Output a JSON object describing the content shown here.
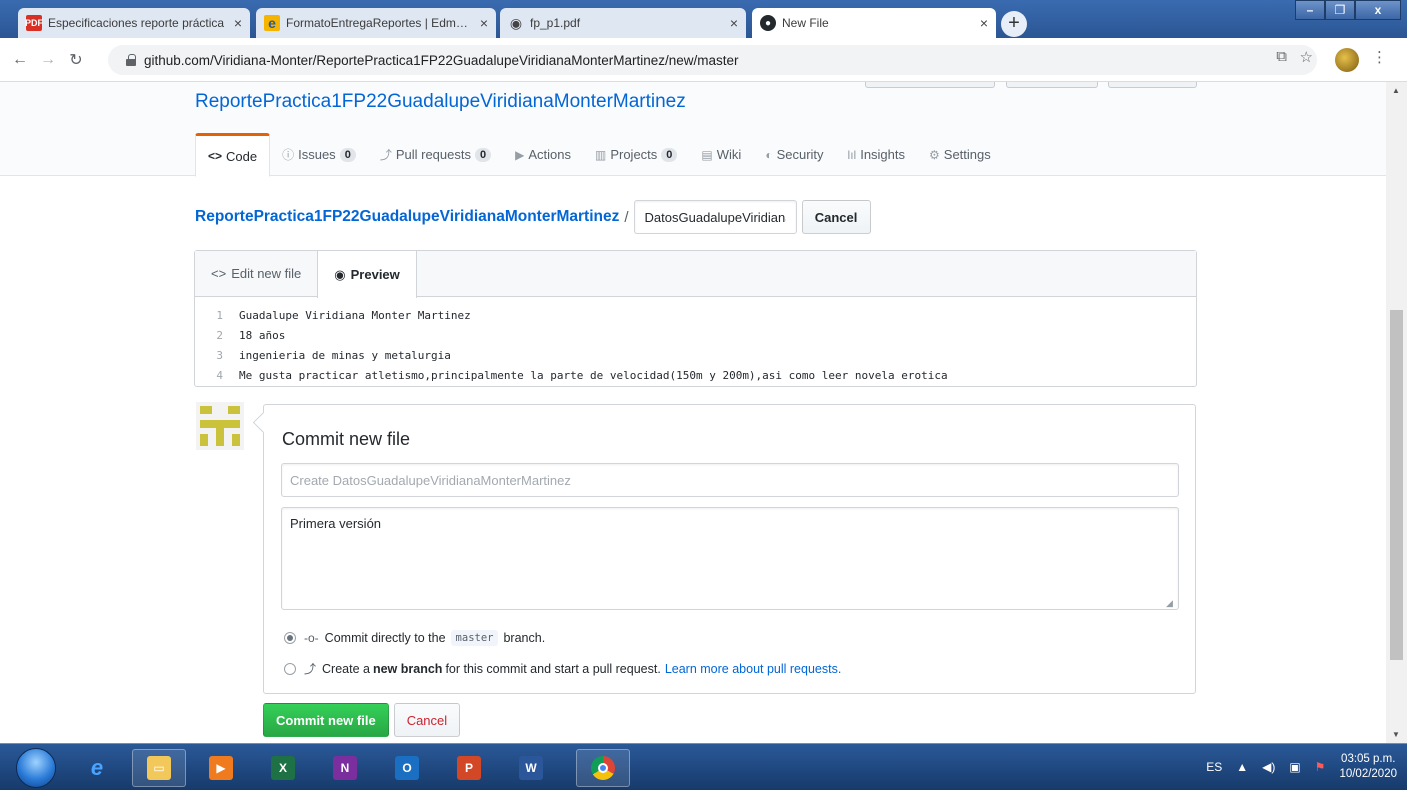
{
  "browser": {
    "tabs": [
      {
        "title": "Especificaciones reporte práctica",
        "favicon": "PDF"
      },
      {
        "title": "FormatoEntregaReportes | Edmodo",
        "favicon": "e"
      },
      {
        "title": "fp_p1.pdf",
        "favicon": "globe-icon"
      },
      {
        "title": "New File",
        "favicon": "github-icon"
      }
    ],
    "url": "github.com/Viridiana-Monter/ReportePractica1FP22GuadalupeViridianaMonterMartinez/new/master"
  },
  "repo": {
    "title": "ReportePractica1FP22GuadalupeViridianaMonterMartinez",
    "nav": [
      {
        "icon": "<>",
        "label": "Code"
      },
      {
        "icon": "ⓘ",
        "label": "Issues",
        "count": "0"
      },
      {
        "icon": "⤴",
        "label": "Pull requests",
        "count": "0"
      },
      {
        "icon": "▶",
        "label": "Actions"
      },
      {
        "icon": "▥",
        "label": "Projects",
        "count": "0"
      },
      {
        "icon": "▤",
        "label": "Wiki"
      },
      {
        "icon": "◐",
        "label": "Security"
      },
      {
        "icon": "lıl",
        "label": "Insights"
      },
      {
        "icon": "⚙",
        "label": "Settings"
      }
    ]
  },
  "breadcrumb": {
    "repo": "ReportePractica1FP22GuadalupeViridianaMonterMartinez",
    "separator": "/",
    "filename": "DatosGuadalupeViridianaMonterMartinez",
    "cancel_label": "Cancel"
  },
  "editor": {
    "tab_edit": "Edit new file",
    "tab_preview": "Preview",
    "lines": [
      {
        "n": "1",
        "text": "Guadalupe Viridiana Monter Martinez"
      },
      {
        "n": "2",
        "text": "18 años"
      },
      {
        "n": "3",
        "text": "ingenieria de minas y metalurgia"
      },
      {
        "n": "4",
        "text": "Me gusta practicar atletismo,principalmente la parte de velocidad(150m y 200m),asi como leer novela erotica"
      }
    ]
  },
  "commit": {
    "heading": "Commit new file",
    "summary_placeholder": "Create DatosGuadalupeViridianaMonterMartinez",
    "description": "Primera versión",
    "option1_prefix": "Commit directly to the",
    "option1_branch": "master",
    "option1_suffix": "branch.",
    "option2_prefix": "Create a",
    "option2_bold": "new branch",
    "option2_suffix": "for this commit and start a pull request.",
    "option2_link": "Learn more about pull requests.",
    "submit_label": "Commit new file",
    "cancel_label": "Cancel"
  },
  "taskbar": {
    "language": "ES",
    "time": "03:05 p.m.",
    "date": "10/02/2020"
  },
  "colors": {
    "link": "#0366d6",
    "primary_button": "#28a745",
    "cancel_text": "#cb2431",
    "tab_accent": "#e36209"
  }
}
